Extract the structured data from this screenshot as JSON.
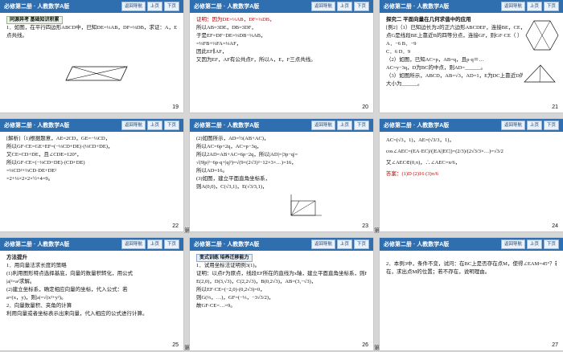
{
  "header": {
    "title": "必修第二册 · 人教数学A版",
    "btn_nav": "返回导航",
    "btn_prev": "上页",
    "btn_next": "下页"
  },
  "gutter_text": "第",
  "slides": [
    {
      "page": "19",
      "lines": [
        "同源异考  基础知识积累",
        "1．如图，在平行四边形ABCD中，已知DE=⅓AB，DF=⅓DB，求证：A，E，F三",
        "点共线。"
      ]
    },
    {
      "page": "20",
      "lines": [
        "证明：因为DE=⅓AB，DF=⅓DB，",
        "所以AB=3DE，DB=3DF，",
        "于是EF=DF−DE=⅓DB−⅓AB，",
        "=⅓FB+⅓FA=⅓AF，",
        "因此EF∥AF，",
        "又因为EF，AF有公共点F，所以A，E，F三点共线。"
      ]
    },
    {
      "page": "21",
      "lines": [
        "探究二  平面向量在几何求值中的应用",
        "[例2]（1）已知边长为2的正六边形ABCDEF，连接BE，CE，",
        "点G是线段BE上靠近B的四等分点，连接GF，则GF·CE（  ）",
        "A．−6                          B．−9",
        "C．6                           D．9",
        "（2）如图，已知AC=p，AB=q，且p·q＝…",
        "AC=y−3q，D为BC的中点，则AD=______。",
        "（3）如图所示，ABCD，AB=√3，AD=1，E为DC上靠近D的三等分点，则∠AEC的",
        "大小为______。"
      ]
    },
    {
      "page": "22",
      "lines": [
        "[解析]（1)根据题意，AE=2CD，GE=−⅓CD，",
        "所以GF·CE=GE+EF=(−⅓CD+DE)·(⅓CD+DE)，",
        "又CE=CD+DE，且∠CDE=120°，",
        "所以GF·CE=(−⅓CD+DE)·(CD+DE)",
        "=⅓CD²+⅔CD·DE+DE²",
        "=2+⅓×2×2×½+4=9。"
      ]
    },
    {
      "page": "23",
      "lines": [
        "(2)如图所示，AD=½(AB+AC)，",
        "所以AC=6p+2q，AC=p−3q，",
        "所以2AD=AB+AC=6p−2q，所以|AD|=|3p−q|=",
        "√(9|p|²−6p·q+|q|²)=√(9×(2√3)²−12×3×…)=16，",
        "所以AD=16。",
        "(3)如图，建立平面直角坐标系，",
        "则A(0,0)，C(√3,1)，E(√3/3,1)，"
      ]
    },
    {
      "page": "24",
      "lines": [
        "AC=(√3，1)，AE=(√3/3，1)，",
        "cos∠AEC=(EA·EC)/(|EA||EC|)=(2/3)/(2√3/3×…)=√3/2",
        "又∠AEC∈(0,π)，∴∠AEC=π/6，",
        "答案：(1)D  (2)16  (3)π/6"
      ]
    },
    {
      "page": "25",
      "lines": [
        "方法提升",
        "1．用向量法求长度的策略",
        "(1)利用图形特点选择基底，向量的数量积转化，用公式",
        "|a|²=a²求解。",
        "(2)建立坐标系，确定相应向量的坐标，代入公式：若",
        "a=(x，y)，则|a|=√(x²+y²)。",
        "2．向量数量积、夹角的计算",
        "利用向量或者坐标表示出来向量，代入相应的公式进行计算。"
      ]
    },
    {
      "page": "26",
      "lines": [
        "变式训练  培养迁移能力",
        "1．试用坐标法证明例3(1)。",
        "证明：以点F为原点，线段EF所在的直线为x轴，建立平面直角坐标系，则F(0,0)，",
        "E(2,0)，D(3,√3)，C(2,2√3)，B(0,2√3)，AB=(3,−√3)，",
        "所以EF·CE=(−2,0)·(0,2√3)=0，",
        "则G(⅓，…)，GF=(−⅓，−3√3/2)，",
        "故GF·CE=…=9。"
      ]
    },
    {
      "page": "27",
      "lines": [
        "2．本例3中，条件不变，试问：在BC上是否存在点M，使得∠EAM=45°？若存",
        "在，求出点M的位置；若不存在，说明理由。"
      ]
    }
  ]
}
